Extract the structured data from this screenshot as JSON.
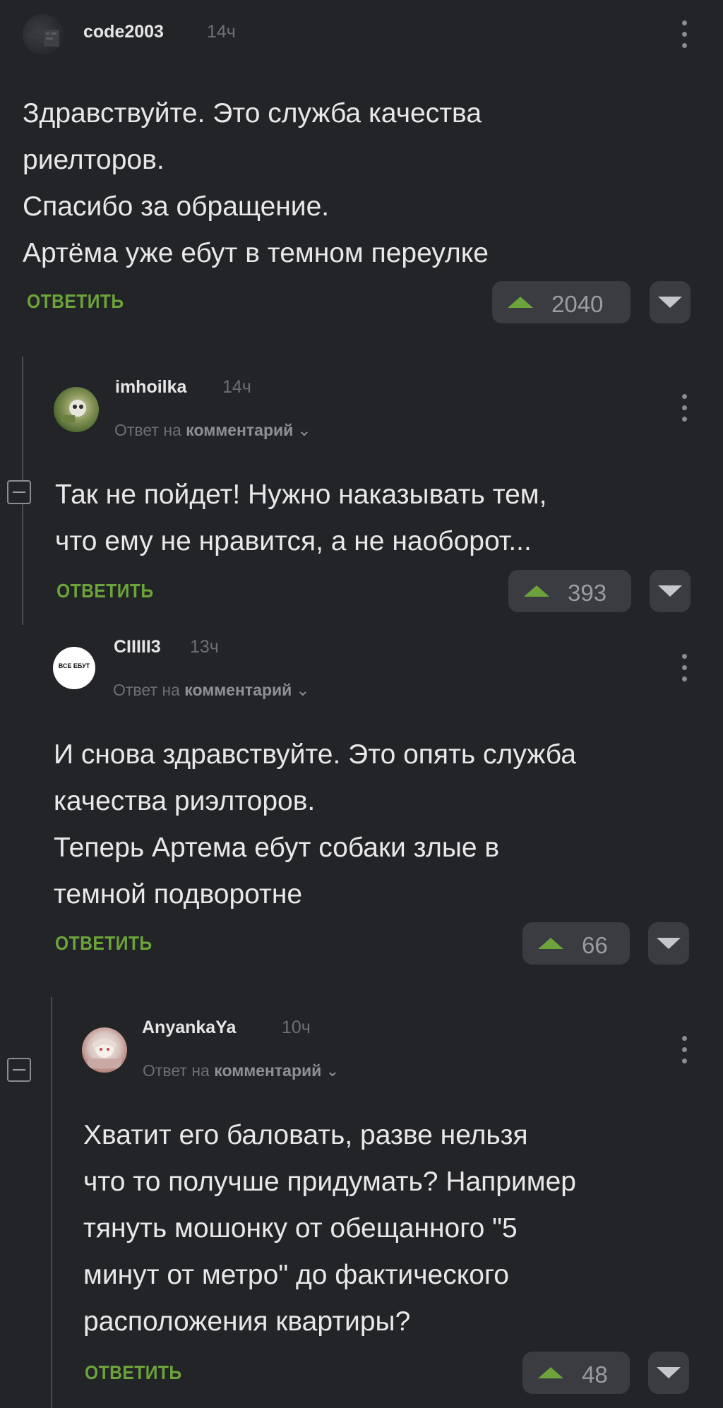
{
  "colors": {
    "background": "#232427",
    "accent_green": "#6ca33a",
    "text": "#e8e8ea",
    "muted": "#6d6f75",
    "pill": "#3a3c41"
  },
  "comments": [
    {
      "username": "code2003",
      "time": "14ч",
      "lines": [
        "Здравствуйте. Это служба качества",
        "риелторов.",
        "Спасибо за обращение.",
        "Артёма уже ебут в темном переулке"
      ],
      "reply_label": "ОТВЕТИТЬ",
      "votes": "2040"
    },
    {
      "username": "imhoilka",
      "time": "14ч",
      "reply_prefix": "Ответ на",
      "reply_target": "комментарий",
      "lines": [
        "Так не пойдет! Нужно наказывать тем,",
        "что ему не нравится, а не наоборот..."
      ],
      "reply_label": "ОТВЕТИТЬ",
      "votes": "393"
    },
    {
      "username": "CIIIII3",
      "time": "13ч",
      "avatar_text": "ВСЕ ЕБУТ",
      "reply_prefix": "Ответ на",
      "reply_target": "комментарий",
      "lines": [
        "И снова здравствуйте. Это опять служба",
        "качества риэлторов.",
        "Теперь Артема ебут собаки злые в",
        "темной подворотне"
      ],
      "reply_label": "ОТВЕТИТЬ",
      "votes": "66"
    },
    {
      "username": "AnyankaYa",
      "time": "10ч",
      "reply_prefix": "Ответ на",
      "reply_target": "комментарий",
      "lines": [
        "Хватит его баловать, разве нельзя",
        "что то получше придумать? Например",
        "тянуть мошонку от обещанного \"5",
        "минут от метро\" до фактического",
        "расположения квартиры?"
      ],
      "reply_label": "ОТВЕТИТЬ",
      "votes": "48"
    }
  ]
}
